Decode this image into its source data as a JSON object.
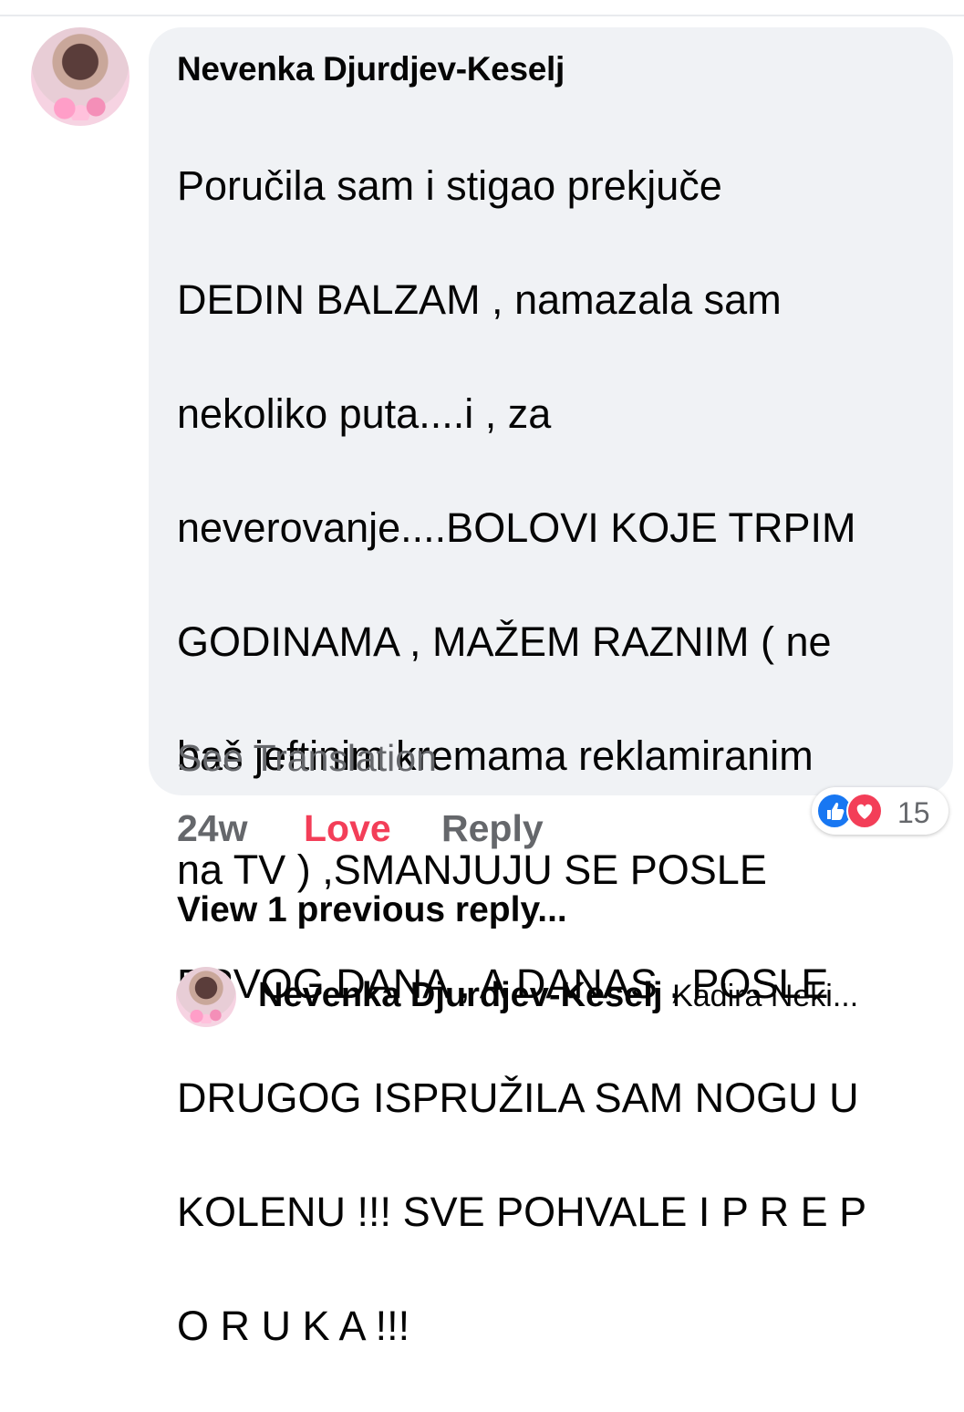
{
  "comment": {
    "author": "Nevenka Djurdjev-Keselj",
    "text_lines": [
      "Poručila sam i stigao prekjuče",
      "DEDIN BALZAM , namazala sam",
      "nekoliko puta....i , za",
      "neverovanje....BOLOVI KOJE TRPIM",
      "GODINAMA , MAŽEM RAZNIM ( ne",
      "baš jeftinim kremama reklamiranim",
      "na TV ) ,SMANJUJU SE POSLE",
      "PRVOG DANA , A DANAS , POSLE",
      "DRUGOG ISPRUŽILA SAM NOGU U",
      "KOLENU !!! SVE POHVALE I P R E P",
      "O R U K A !!!"
    ],
    "see_translation": "See Translation",
    "reaction_count": "15",
    "reaction_icons": [
      "like-icon",
      "love-icon"
    ],
    "actions": {
      "time": "24w",
      "love": "Love",
      "reply": "Reply"
    }
  },
  "replies": {
    "view_previous": "View 1 previous reply...",
    "latest": {
      "author": "Nevenka Djurdjev-Keselj",
      "snippet": "Kadira Neki..."
    }
  },
  "colors": {
    "bubble": "#f0f2f5",
    "love": "#f33e58",
    "like": "#1877f2",
    "muted": "#65676b"
  }
}
